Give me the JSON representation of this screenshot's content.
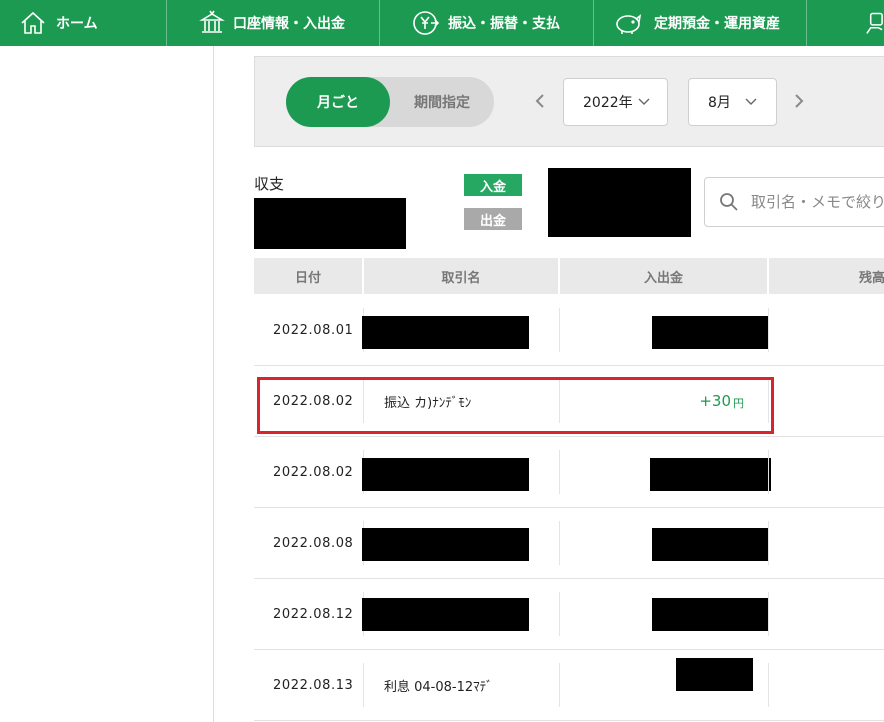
{
  "nav": {
    "home": "ホーム",
    "account": "口座情報・入出金",
    "transfer": "振込・振替・支払",
    "deposit": "定期預金・運用資産"
  },
  "filter": {
    "mode_monthly": "月ごと",
    "mode_period": "期間指定",
    "year": "2022年",
    "month": "8月"
  },
  "summary": {
    "label": "収支",
    "badge_in": "入金",
    "badge_out": "出金"
  },
  "search": {
    "placeholder": "取引名・メモで絞り込み"
  },
  "table": {
    "headers": {
      "date": "日付",
      "name": "取引名",
      "amount": "入出金",
      "balance": "残高"
    },
    "rows": [
      {
        "date": "2022.08.01",
        "name": "",
        "amount": ""
      },
      {
        "date": "2022.08.02",
        "name": "振込 カ)ﾅﾝﾃﾞﾓﾝ",
        "amount": "+30",
        "unit": "円"
      },
      {
        "date": "2022.08.02",
        "name": "",
        "amount": ""
      },
      {
        "date": "2022.08.08",
        "name": "",
        "amount": ""
      },
      {
        "date": "2022.08.12",
        "name": "",
        "amount": ""
      },
      {
        "date": "2022.08.13",
        "name": "利息 04-08-12ﾏﾃﾞ",
        "amount": ""
      }
    ]
  },
  "colors": {
    "brand_green": "#1d9a52",
    "highlight_red": "#d8242c"
  }
}
